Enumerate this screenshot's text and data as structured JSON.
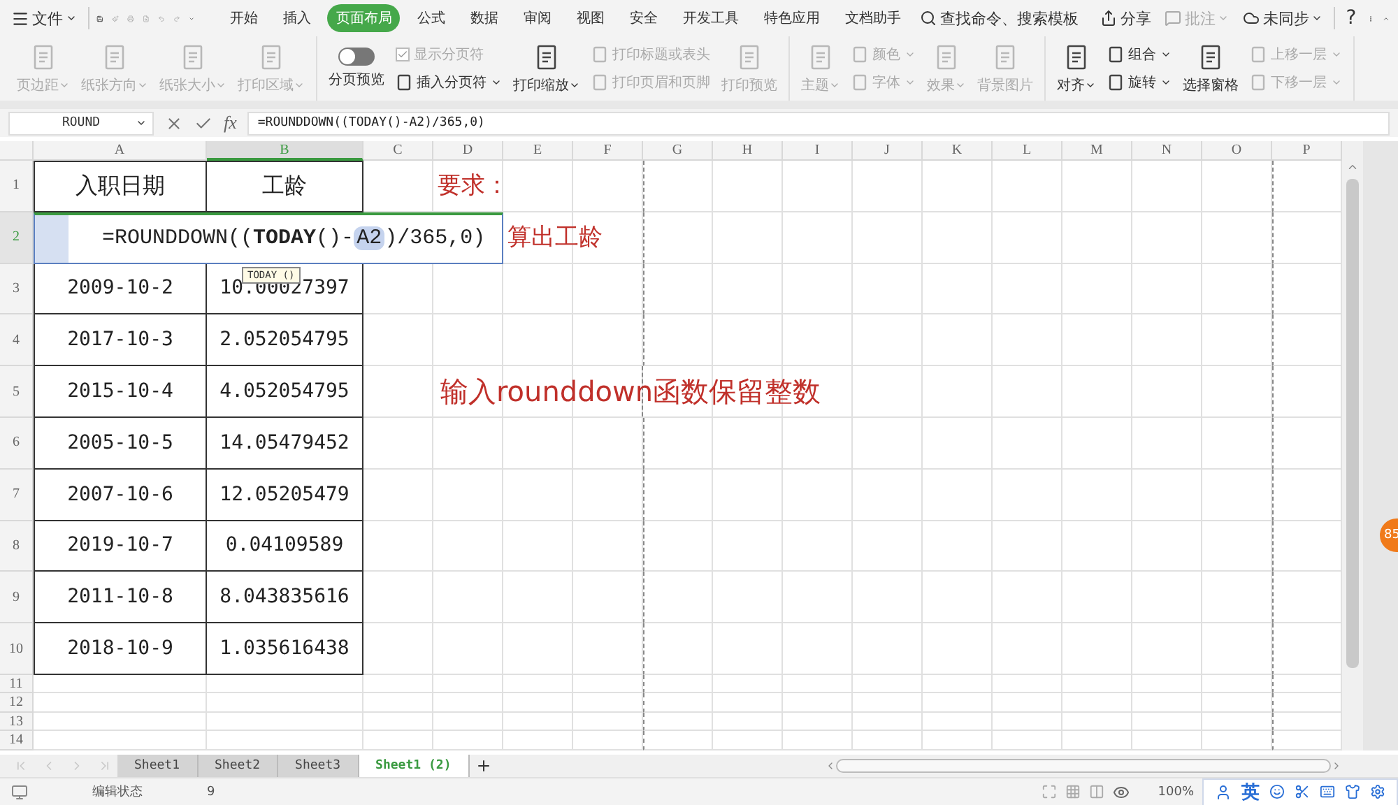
{
  "menu": {
    "file_label": "文件",
    "tabs": [
      {
        "label": "开始",
        "selected": false
      },
      {
        "label": "插入",
        "selected": false
      },
      {
        "label": "页面布局",
        "selected": true
      },
      {
        "label": "公式",
        "selected": false
      },
      {
        "label": "数据",
        "selected": false
      },
      {
        "label": "审阅",
        "selected": false
      },
      {
        "label": "视图",
        "selected": false
      },
      {
        "label": "安全",
        "selected": false
      },
      {
        "label": "开发工具",
        "selected": false
      },
      {
        "label": "特色应用",
        "selected": false
      },
      {
        "label": "文档助手",
        "selected": false
      }
    ],
    "search_label": "查找命令、搜索模板",
    "share_label": "分享",
    "comment_label": "批注",
    "sync_label": "未同步",
    "help_label": "?"
  },
  "ribbon": {
    "groups": [
      {
        "columns": [
          {
            "kind": "large",
            "label": "页边距",
            "disabled": true,
            "dropdown": true
          },
          {
            "kind": "large",
            "label": "纸张方向",
            "disabled": true,
            "dropdown": true
          },
          {
            "kind": "large",
            "label": "纸张大小",
            "disabled": true,
            "dropdown": true
          },
          {
            "kind": "large",
            "label": "打印区域",
            "disabled": true,
            "dropdown": true
          }
        ]
      },
      {
        "columns": [
          {
            "kind": "toggle",
            "label": "分页预览",
            "on": false
          },
          {
            "kind": "stack",
            "items": [
              {
                "kind": "checkbox",
                "label": "显示分页符",
                "checked": true,
                "disabled": true,
                "dropdown": false
              },
              {
                "kind": "button",
                "label": "插入分页符",
                "disabled": false,
                "dropdown": true
              }
            ]
          },
          {
            "kind": "large",
            "label": "打印缩放",
            "disabled": false,
            "dropdown": true
          },
          {
            "kind": "stack",
            "items": [
              {
                "kind": "button",
                "label": "打印标题或表头",
                "disabled": true,
                "dropdown": false
              },
              {
                "kind": "button",
                "label": "打印页眉和页脚",
                "disabled": true,
                "dropdown": false
              }
            ]
          },
          {
            "kind": "large",
            "label": "打印预览",
            "disabled": true,
            "dropdown": false
          }
        ]
      },
      {
        "columns": [
          {
            "kind": "large",
            "label": "主题",
            "disabled": true,
            "dropdown": true
          },
          {
            "kind": "stack",
            "items": [
              {
                "kind": "button",
                "label": "颜色",
                "disabled": true,
                "dropdown": true
              },
              {
                "kind": "button",
                "label": "字体",
                "disabled": true,
                "dropdown": true
              }
            ]
          },
          {
            "kind": "large",
            "label": "效果",
            "disabled": true,
            "dropdown": true
          },
          {
            "kind": "large",
            "label": "背景图片",
            "disabled": true,
            "dropdown": false
          }
        ]
      },
      {
        "columns": [
          {
            "kind": "large",
            "label": "对齐",
            "disabled": false,
            "dropdown": true
          },
          {
            "kind": "stack",
            "items": [
              {
                "kind": "button",
                "label": "组合",
                "disabled": false,
                "dropdown": true
              },
              {
                "kind": "button",
                "label": "旋转",
                "disabled": false,
                "dropdown": true
              }
            ]
          },
          {
            "kind": "large",
            "label": "选择窗格",
            "disabled": false,
            "dropdown": false
          },
          {
            "kind": "stack",
            "items": [
              {
                "kind": "button",
                "label": "上移一层",
                "disabled": true,
                "dropdown": true
              },
              {
                "kind": "button",
                "label": "下移一层",
                "disabled": true,
                "dropdown": true
              }
            ]
          }
        ]
      }
    ]
  },
  "formula_bar": {
    "name_box": "ROUND",
    "fx_label": "fx",
    "formula": "=ROUNDDOWN((TODAY()-A2)/365,0)"
  },
  "sheet": {
    "columns": [
      {
        "label": "A",
        "selected": false,
        "page_break": false
      },
      {
        "label": "B",
        "selected": true,
        "page_break": false
      },
      {
        "label": "C",
        "selected": false,
        "page_break": false
      },
      {
        "label": "D",
        "selected": false,
        "page_break": false
      },
      {
        "label": "E",
        "selected": false,
        "page_break": false
      },
      {
        "label": "F",
        "selected": false,
        "page_break": false
      },
      {
        "label": "G",
        "selected": false,
        "page_break": true
      },
      {
        "label": "H",
        "selected": false,
        "page_break": false
      },
      {
        "label": "I",
        "selected": false,
        "page_break": false
      },
      {
        "label": "J",
        "selected": false,
        "page_break": false
      },
      {
        "label": "K",
        "selected": false,
        "page_break": false
      },
      {
        "label": "L",
        "selected": false,
        "page_break": false
      },
      {
        "label": "M",
        "selected": false,
        "page_break": false
      },
      {
        "label": "N",
        "selected": false,
        "page_break": false
      },
      {
        "label": "O",
        "selected": false,
        "page_break": false
      },
      {
        "label": "P",
        "selected": false,
        "page_break": true
      }
    ],
    "rows": [
      {
        "label": "1",
        "selected": false,
        "editing": false,
        "cells": [
          "入职日期",
          "工龄"
        ],
        "note": {
          "text": "要求：",
          "kind": "small"
        }
      },
      {
        "label": "2",
        "selected": true,
        "editing": true,
        "formula_parts": [
          {
            "text": "=ROUNDDOWN((",
            "kind": "plain"
          },
          {
            "text": "TODAY",
            "kind": "bold"
          },
          {
            "text": "()-",
            "kind": "plain"
          },
          {
            "text": "A2",
            "kind": "reference"
          },
          {
            "text": ")/365,0)",
            "kind": "plain"
          }
        ],
        "tooltip": "TODAY ()",
        "note": {
          "text": "算出工龄",
          "kind": "small"
        }
      },
      {
        "label": "3",
        "selected": false,
        "editing": false,
        "cells": [
          "2009-10-2",
          "10.00027397"
        ]
      },
      {
        "label": "4",
        "selected": false,
        "editing": false,
        "cells": [
          "2017-10-3",
          "2.052054795"
        ]
      },
      {
        "label": "5",
        "selected": false,
        "editing": false,
        "cells": [
          "2015-10-4",
          "4.052054795"
        ],
        "note": {
          "text": "输入rounddown函数保留整数",
          "kind": "large"
        }
      },
      {
        "label": "6",
        "selected": false,
        "editing": false,
        "cells": [
          "2005-10-5",
          "14.05479452"
        ]
      },
      {
        "label": "7",
        "selected": false,
        "editing": false,
        "cells": [
          "2007-10-6",
          "12.05205479"
        ]
      },
      {
        "label": "8",
        "selected": false,
        "editing": false,
        "cells": [
          "2019-10-7",
          "0.04109589"
        ]
      },
      {
        "label": "9",
        "selected": false,
        "editing": false,
        "cells": [
          "2011-10-8",
          "8.043835616"
        ]
      },
      {
        "label": "10",
        "selected": false,
        "editing": false,
        "cells": [
          "2018-10-9",
          "1.035616438"
        ]
      },
      {
        "label": "11",
        "selected": false,
        "editing": false
      },
      {
        "label": "12",
        "selected": false,
        "editing": false
      },
      {
        "label": "13",
        "selected": false,
        "editing": false
      },
      {
        "label": "14",
        "selected": false,
        "editing": false
      }
    ],
    "side_badge": "85"
  },
  "sheet_tabs": [
    {
      "label": "Sheet1",
      "selected": false
    },
    {
      "label": "Sheet2",
      "selected": false
    },
    {
      "label": "Sheet3",
      "selected": false
    },
    {
      "label": "Sheet1 (2)",
      "selected": true
    }
  ],
  "status_bar": {
    "mode": "编辑状态",
    "count": "9",
    "zoom": "100%",
    "ime_label": "英"
  }
}
